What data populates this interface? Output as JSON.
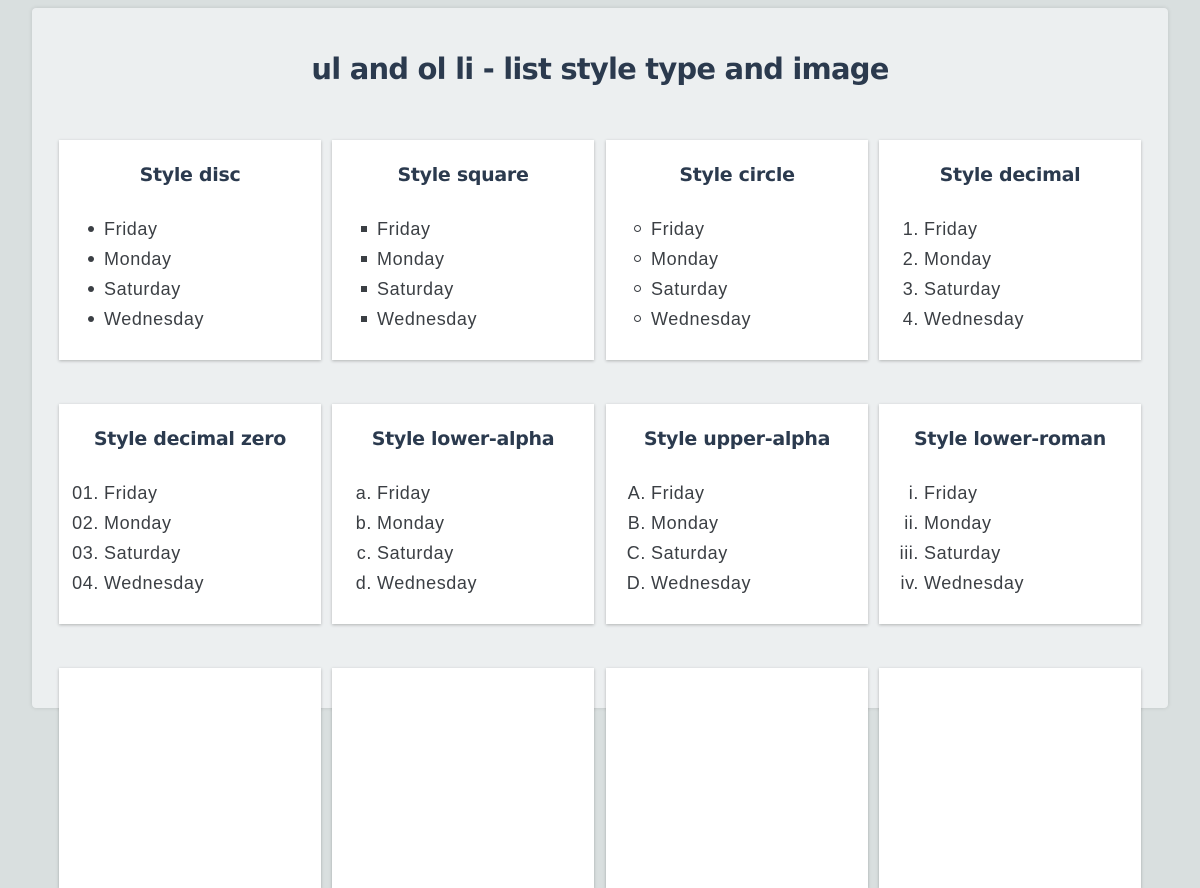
{
  "page": {
    "title": "ul and ol li - list style type and image"
  },
  "cards": [
    {
      "title": "Style disc",
      "markers": [
        "",
        "",
        "",
        ""
      ],
      "style": "disc",
      "items": [
        "Friday",
        "Monday",
        "Saturday",
        "Wednesday"
      ]
    },
    {
      "title": "Style square",
      "markers": [
        "",
        "",
        "",
        ""
      ],
      "style": "square",
      "items": [
        "Friday",
        "Monday",
        "Saturday",
        "Wednesday"
      ]
    },
    {
      "title": "Style circle",
      "markers": [
        "",
        "",
        "",
        ""
      ],
      "style": "circle",
      "items": [
        "Friday",
        "Monday",
        "Saturday",
        "Wednesday"
      ]
    },
    {
      "title": "Style decimal",
      "markers": [
        "1.",
        "2.",
        "3.",
        "4."
      ],
      "style": "text",
      "items": [
        "Friday",
        "Monday",
        "Saturday",
        "Wednesday"
      ]
    },
    {
      "title": "Style decimal zero",
      "markers": [
        "01.",
        "02.",
        "03.",
        "04."
      ],
      "style": "text",
      "items": [
        "Friday",
        "Monday",
        "Saturday",
        "Wednesday"
      ]
    },
    {
      "title": "Style lower-alpha",
      "markers": [
        "a.",
        "b.",
        "c.",
        "d."
      ],
      "style": "text",
      "items": [
        "Friday",
        "Monday",
        "Saturday",
        "Wednesday"
      ]
    },
    {
      "title": "Style upper-alpha",
      "markers": [
        "A.",
        "B.",
        "C.",
        "D."
      ],
      "style": "text",
      "items": [
        "Friday",
        "Monday",
        "Saturday",
        "Wednesday"
      ]
    },
    {
      "title": "Style lower-roman",
      "markers": [
        "i.",
        "ii.",
        "iii.",
        "iv."
      ],
      "style": "text",
      "items": [
        "Friday",
        "Monday",
        "Saturday",
        "Wednesday"
      ]
    }
  ],
  "colors": {
    "background": "#d9dfdf",
    "panel": "#eceff0",
    "card": "#ffffff",
    "heading": "#2b3a4e",
    "text": "#3b3f44"
  }
}
